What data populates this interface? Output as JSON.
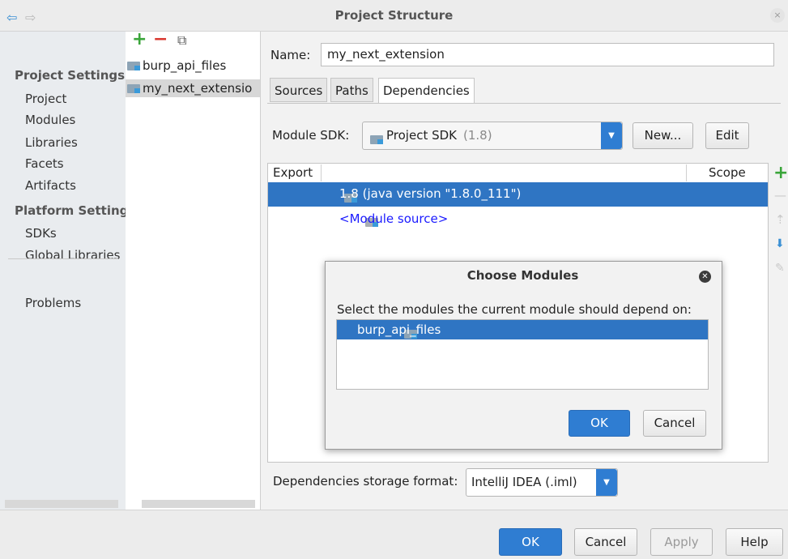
{
  "window": {
    "title": "Project Structure",
    "close_glyph": "×"
  },
  "nav": {
    "back_glyph": "⇦",
    "forward_glyph": "⇨",
    "project_settings_heading": "Project Settings",
    "project_items": [
      "Project",
      "Modules",
      "Libraries",
      "Facets",
      "Artifacts"
    ],
    "platform_settings_heading": "Platform Setting",
    "platform_items": [
      "SDKs",
      "Global Libraries"
    ],
    "problems": "Problems"
  },
  "module_toolbar": {
    "add_glyph": "+",
    "remove_glyph": "−",
    "copy_glyph": "⧉"
  },
  "modules": [
    "burp_api_files",
    "my_next_extensio"
  ],
  "name_field": {
    "label": "Name:",
    "value": "my_next_extension"
  },
  "tabs": [
    "Sources",
    "Paths",
    "Dependencies"
  ],
  "module_sdk": {
    "label": "Module SDK:",
    "value": "Project SDK",
    "version": "(1.8)",
    "new_button": "New...",
    "edit_button": "Edit"
  },
  "dependencies": {
    "col_export": "Export",
    "col_scope": "Scope",
    "rows": [
      "1.8 (java version \"1.8.0_111\")",
      "<Module source>"
    ]
  },
  "side_tools": {
    "add": "+",
    "remove": "—",
    "up": "⇡",
    "down": "⬇",
    "edit": "✎"
  },
  "storage_format": {
    "label": "Dependencies storage format:",
    "value": "IntelliJ IDEA (.iml)"
  },
  "dialog": {
    "title": "Choose Modules",
    "close_glyph": "✕",
    "prompt": "Select the modules the current module should depend on:",
    "items": [
      "burp_api_files"
    ],
    "ok": "OK",
    "cancel": "Cancel"
  },
  "footer": {
    "ok": "OK",
    "cancel": "Cancel",
    "apply": "Apply",
    "help": "Help"
  },
  "colors": {
    "accent": "#2f7dd2",
    "selection": "#2f75c3",
    "add_green": "#3aa53a",
    "link_blue": "#1a1aff"
  }
}
